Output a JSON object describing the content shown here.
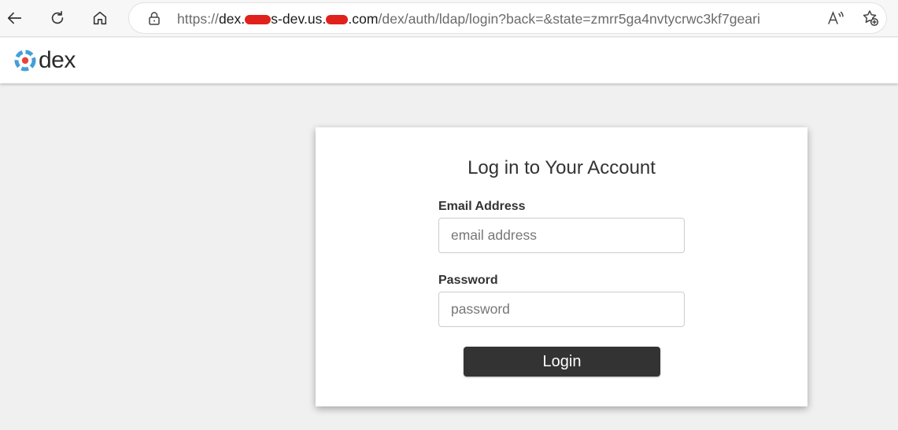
{
  "browser": {
    "url_scheme": "https://",
    "url_host_prefix": "dex.",
    "url_host_mid": "s-dev.us.",
    "url_host_suffix": ".com",
    "url_path": "/dex/auth/ldap/login?back=&state=zmrr5ga4nvtycrwc3kf7geari",
    "redaction_color": "#e0211c",
    "icons": [
      "back-arrow-icon",
      "refresh-icon",
      "home-icon",
      "lock-icon",
      "read-aloud-icon",
      "add-favorite-icon"
    ]
  },
  "header": {
    "logo_text": "dex",
    "logo_colors": [
      "#449fd8",
      "#e8433b"
    ]
  },
  "login": {
    "title": "Log in to Your Account",
    "email_label": "Email Address",
    "email_placeholder": "email address",
    "email_value": "",
    "password_label": "Password",
    "password_placeholder": "password",
    "password_value": "",
    "button_label": "Login",
    "button_color": "#333333"
  }
}
